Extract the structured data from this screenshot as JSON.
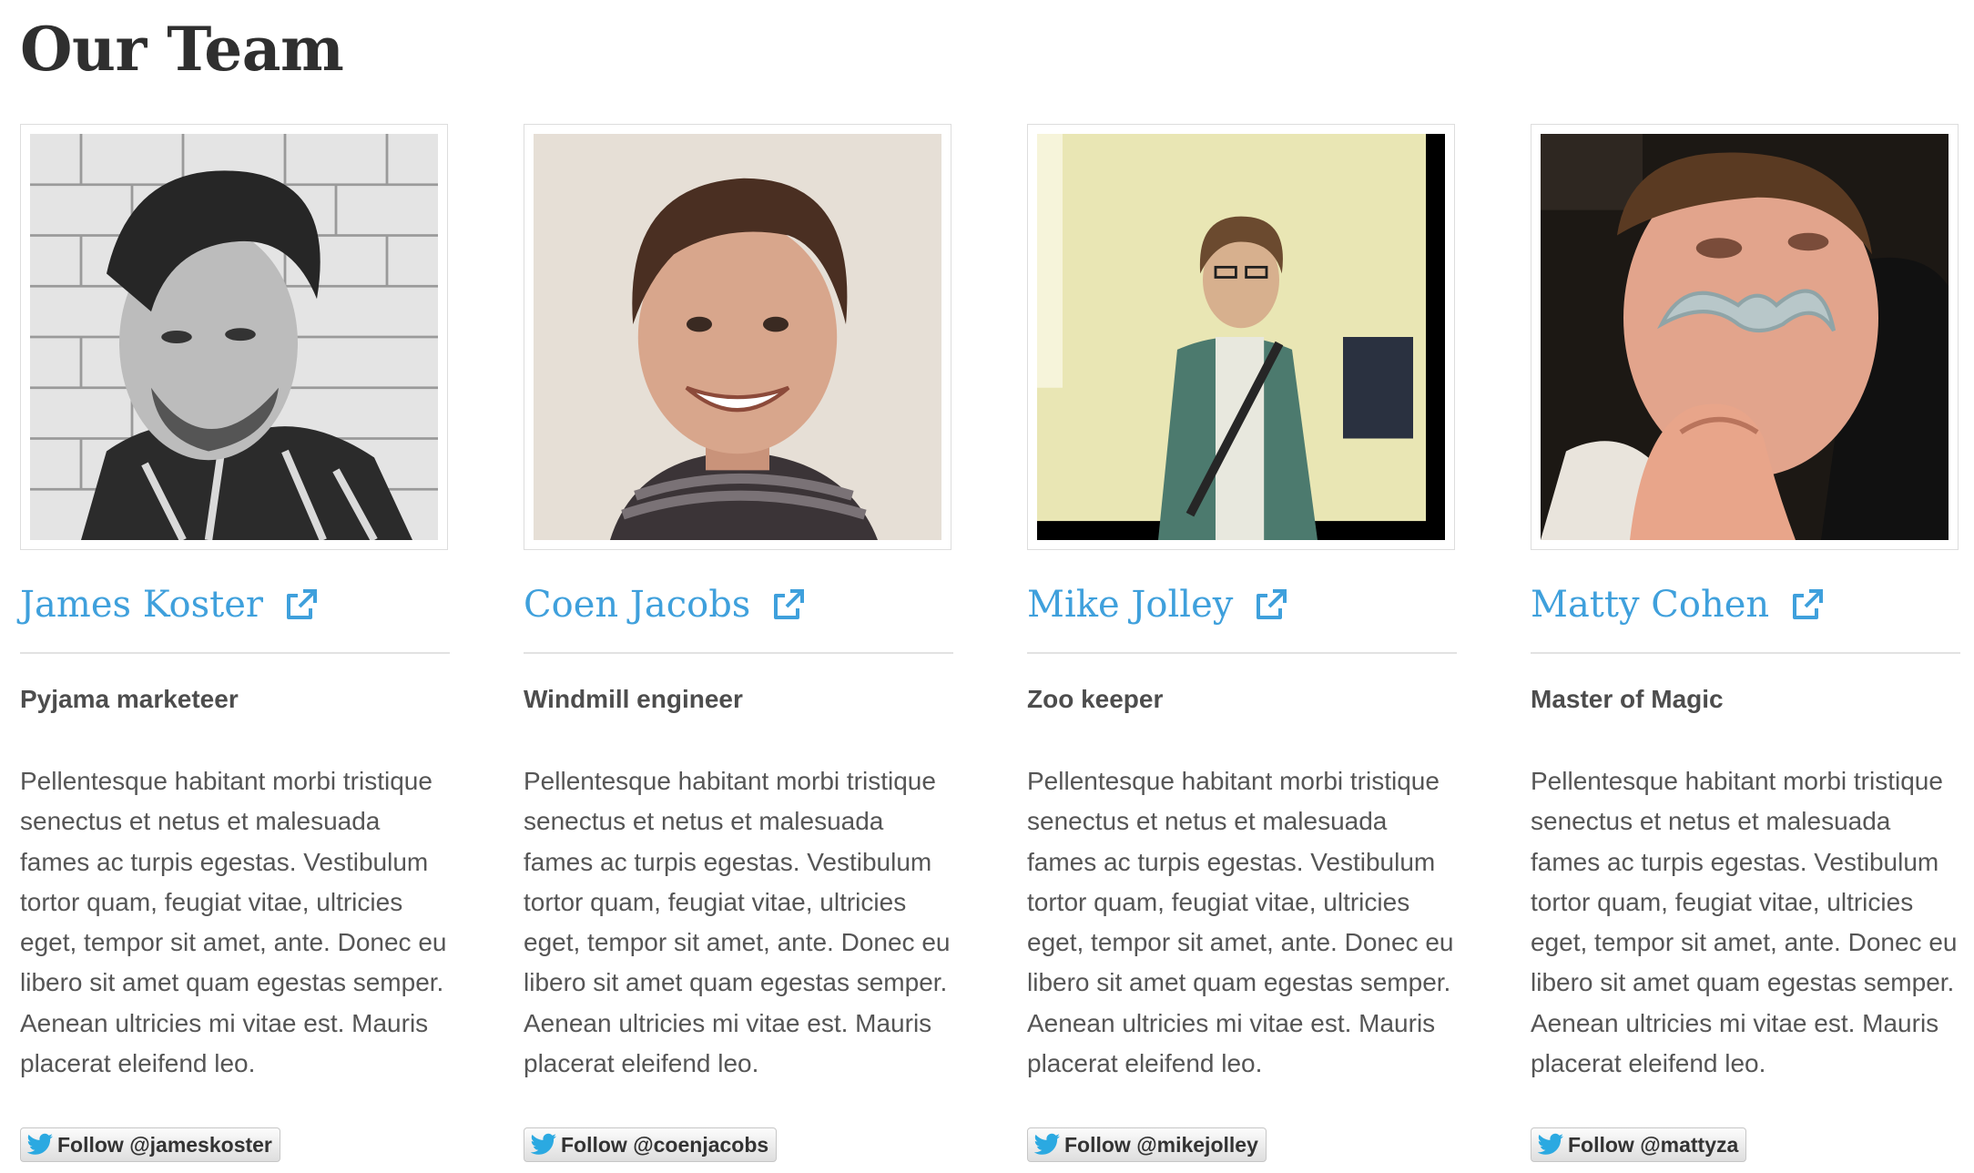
{
  "page": {
    "title": "Our Team"
  },
  "colors": {
    "accent": "#3fa0dc",
    "divider": "#e2e2e2",
    "text": "#555555",
    "twitter_blue": "#2ba9e1"
  },
  "icons": {
    "name_link": "external-link-icon",
    "follow": "twitter-bird-icon"
  },
  "team": [
    {
      "name": "James Koster",
      "role": "Pyjama marketeer",
      "bio": "Pellentesque habitant morbi tristique senectus et netus et malesuada fames ac turpis egestas. Vestibulum tortor quam, feugiat vitae, ultricies eget, tempor sit amet, ante. Donec eu libero sit amet quam egestas semper. Aenean ultricies mi vitae est. Mauris placerat eleifend leo.",
      "follow_label": "Follow @jameskoster"
    },
    {
      "name": "Coen Jacobs",
      "role": "Windmill engineer",
      "bio": "Pellentesque habitant morbi tristique senectus et netus et malesuada fames ac turpis egestas. Vestibulum tortor quam, feugiat vitae, ultricies eget, tempor sit amet, ante. Donec eu libero sit amet quam egestas semper. Aenean ultricies mi vitae est. Mauris placerat eleifend leo.",
      "follow_label": "Follow @coenjacobs"
    },
    {
      "name": "Mike Jolley",
      "role": "Zoo keeper",
      "bio": "Pellentesque habitant morbi tristique senectus et netus et malesuada fames ac turpis egestas. Vestibulum tortor quam, feugiat vitae, ultricies eget, tempor sit amet, ante. Donec eu libero sit amet quam egestas semper. Aenean ultricies mi vitae est. Mauris placerat eleifend leo.",
      "follow_label": "Follow @mikejolley"
    },
    {
      "name": "Matty Cohen",
      "role": "Master of Magic",
      "bio": "Pellentesque habitant morbi tristique senectus et netus et malesuada fames ac turpis egestas. Vestibulum tortor quam, feugiat vitae, ultricies eget, tempor sit amet, ante. Donec eu libero sit amet quam egestas semper. Aenean ultricies mi vitae est. Mauris placerat eleifend leo.",
      "follow_label": "Follow @mattyza"
    }
  ]
}
